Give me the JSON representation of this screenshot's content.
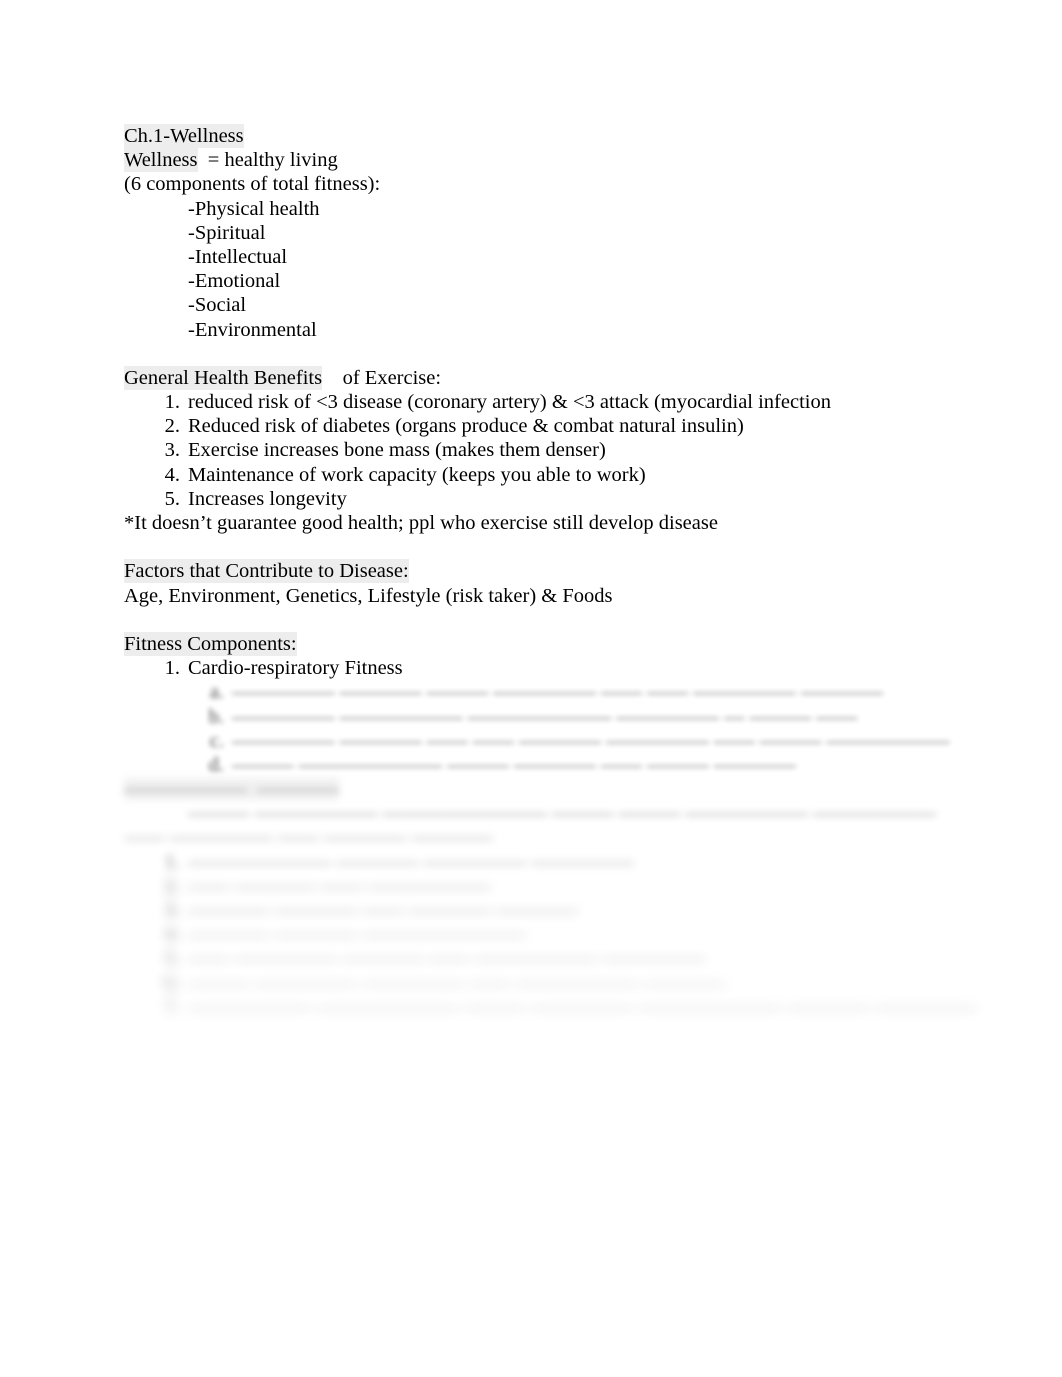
{
  "document": {
    "title_line": "Ch.1-Wellness",
    "definition_line": {
      "term": "Wellness",
      "rest": "  = healthy living"
    },
    "components_intro": "(6 components of total fitness):",
    "components": [
      "-Physical health",
      "-Spiritual",
      "-Intellectual",
      "-Emotional",
      "-Social",
      "-Environmental"
    ],
    "benefits_heading": {
      "highlighted": "General Health Benefits",
      "rest": "    of Exercise:"
    },
    "benefits": [
      {
        "num": "1.",
        "text": "reduced risk of <3 disease (coronary artery) & <3 attack (myocardial infection"
      },
      {
        "num": "2.",
        "text": "Reduced risk of diabetes (organs produce & combat natural insulin)"
      },
      {
        "num": "3.",
        "text": "Exercise increases bone mass (makes them denser)"
      },
      {
        "num": "4.",
        "text": "Maintenance of work capacity (keeps you able to work)"
      },
      {
        "num": "5.",
        "text": "Increases longevity"
      }
    ],
    "benefits_note": "*It doesn’t guarantee good health; ppl who exercise still develop disease",
    "factors_heading": "Factors that Contribute to Disease:",
    "factors_line": "Age, Environment, Genetics, Lifestyle (risk taker) & Foods",
    "fitness_heading": "Fitness Components:",
    "fitness_items": [
      {
        "num": "1.",
        "text": "Cardio-respiratory Fitness"
      }
    ],
    "obscured": {
      "note": "Lower portion of the page is blurred and illegible in the screenshot.",
      "sub_items": [
        {
          "num": "a.",
          "text": "————— ———— ——— ————— —— —— ————— ————"
        },
        {
          "num": "b.",
          "text": "————— —————— ——————— ————— — ——— ——"
        },
        {
          "num": "c.",
          "text": "————— ———— —— —— ———— ————— —— ——— ——————"
        },
        {
          "num": "d.",
          "text": "——— ——————— ——— ———— —— ——— ————"
        }
      ],
      "heading_1": "——————  ————",
      "heading_1_sub": "——— —————— ———————— ——— ——— —————— ——————",
      "heading_2": "—— ————— —— ———— ————",
      "list_items": [
        {
          "num": "1.",
          "text": "——————— ———— ————— —————"
        },
        {
          "num": "2.",
          "text": "—— ———— —— ——————"
        },
        {
          "num": "3.",
          "text": "———— ———— —— ———— ————"
        },
        {
          "num": "4.",
          "text": "———— ———— ————————"
        },
        {
          "num": "5.",
          "text": "—— ————— ———— —— —————— —————"
        },
        {
          "num": "6.",
          "text": "——— ————— ————— —— —————— ————"
        },
        {
          "num": "7.",
          "text": "—————— ——————— ——— ————— ——————— ———— —————"
        }
      ]
    }
  }
}
